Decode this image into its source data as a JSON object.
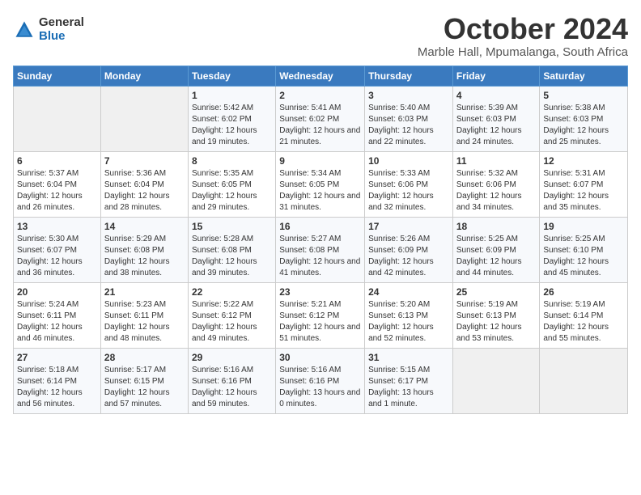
{
  "logo": {
    "general": "General",
    "blue": "Blue"
  },
  "title": "October 2024",
  "location": "Marble Hall, Mpumalanga, South Africa",
  "headers": [
    "Sunday",
    "Monday",
    "Tuesday",
    "Wednesday",
    "Thursday",
    "Friday",
    "Saturday"
  ],
  "weeks": [
    [
      {
        "day": "",
        "info": ""
      },
      {
        "day": "",
        "info": ""
      },
      {
        "day": "1",
        "info": "Sunrise: 5:42 AM\nSunset: 6:02 PM\nDaylight: 12 hours and 19 minutes."
      },
      {
        "day": "2",
        "info": "Sunrise: 5:41 AM\nSunset: 6:02 PM\nDaylight: 12 hours and 21 minutes."
      },
      {
        "day": "3",
        "info": "Sunrise: 5:40 AM\nSunset: 6:03 PM\nDaylight: 12 hours and 22 minutes."
      },
      {
        "day": "4",
        "info": "Sunrise: 5:39 AM\nSunset: 6:03 PM\nDaylight: 12 hours and 24 minutes."
      },
      {
        "day": "5",
        "info": "Sunrise: 5:38 AM\nSunset: 6:03 PM\nDaylight: 12 hours and 25 minutes."
      }
    ],
    [
      {
        "day": "6",
        "info": "Sunrise: 5:37 AM\nSunset: 6:04 PM\nDaylight: 12 hours and 26 minutes."
      },
      {
        "day": "7",
        "info": "Sunrise: 5:36 AM\nSunset: 6:04 PM\nDaylight: 12 hours and 28 minutes."
      },
      {
        "day": "8",
        "info": "Sunrise: 5:35 AM\nSunset: 6:05 PM\nDaylight: 12 hours and 29 minutes."
      },
      {
        "day": "9",
        "info": "Sunrise: 5:34 AM\nSunset: 6:05 PM\nDaylight: 12 hours and 31 minutes."
      },
      {
        "day": "10",
        "info": "Sunrise: 5:33 AM\nSunset: 6:06 PM\nDaylight: 12 hours and 32 minutes."
      },
      {
        "day": "11",
        "info": "Sunrise: 5:32 AM\nSunset: 6:06 PM\nDaylight: 12 hours and 34 minutes."
      },
      {
        "day": "12",
        "info": "Sunrise: 5:31 AM\nSunset: 6:07 PM\nDaylight: 12 hours and 35 minutes."
      }
    ],
    [
      {
        "day": "13",
        "info": "Sunrise: 5:30 AM\nSunset: 6:07 PM\nDaylight: 12 hours and 36 minutes."
      },
      {
        "day": "14",
        "info": "Sunrise: 5:29 AM\nSunset: 6:08 PM\nDaylight: 12 hours and 38 minutes."
      },
      {
        "day": "15",
        "info": "Sunrise: 5:28 AM\nSunset: 6:08 PM\nDaylight: 12 hours and 39 minutes."
      },
      {
        "day": "16",
        "info": "Sunrise: 5:27 AM\nSunset: 6:08 PM\nDaylight: 12 hours and 41 minutes."
      },
      {
        "day": "17",
        "info": "Sunrise: 5:26 AM\nSunset: 6:09 PM\nDaylight: 12 hours and 42 minutes."
      },
      {
        "day": "18",
        "info": "Sunrise: 5:25 AM\nSunset: 6:09 PM\nDaylight: 12 hours and 44 minutes."
      },
      {
        "day": "19",
        "info": "Sunrise: 5:25 AM\nSunset: 6:10 PM\nDaylight: 12 hours and 45 minutes."
      }
    ],
    [
      {
        "day": "20",
        "info": "Sunrise: 5:24 AM\nSunset: 6:11 PM\nDaylight: 12 hours and 46 minutes."
      },
      {
        "day": "21",
        "info": "Sunrise: 5:23 AM\nSunset: 6:11 PM\nDaylight: 12 hours and 48 minutes."
      },
      {
        "day": "22",
        "info": "Sunrise: 5:22 AM\nSunset: 6:12 PM\nDaylight: 12 hours and 49 minutes."
      },
      {
        "day": "23",
        "info": "Sunrise: 5:21 AM\nSunset: 6:12 PM\nDaylight: 12 hours and 51 minutes."
      },
      {
        "day": "24",
        "info": "Sunrise: 5:20 AM\nSunset: 6:13 PM\nDaylight: 12 hours and 52 minutes."
      },
      {
        "day": "25",
        "info": "Sunrise: 5:19 AM\nSunset: 6:13 PM\nDaylight: 12 hours and 53 minutes."
      },
      {
        "day": "26",
        "info": "Sunrise: 5:19 AM\nSunset: 6:14 PM\nDaylight: 12 hours and 55 minutes."
      }
    ],
    [
      {
        "day": "27",
        "info": "Sunrise: 5:18 AM\nSunset: 6:14 PM\nDaylight: 12 hours and 56 minutes."
      },
      {
        "day": "28",
        "info": "Sunrise: 5:17 AM\nSunset: 6:15 PM\nDaylight: 12 hours and 57 minutes."
      },
      {
        "day": "29",
        "info": "Sunrise: 5:16 AM\nSunset: 6:16 PM\nDaylight: 12 hours and 59 minutes."
      },
      {
        "day": "30",
        "info": "Sunrise: 5:16 AM\nSunset: 6:16 PM\nDaylight: 13 hours and 0 minutes."
      },
      {
        "day": "31",
        "info": "Sunrise: 5:15 AM\nSunset: 6:17 PM\nDaylight: 13 hours and 1 minute."
      },
      {
        "day": "",
        "info": ""
      },
      {
        "day": "",
        "info": ""
      }
    ]
  ]
}
